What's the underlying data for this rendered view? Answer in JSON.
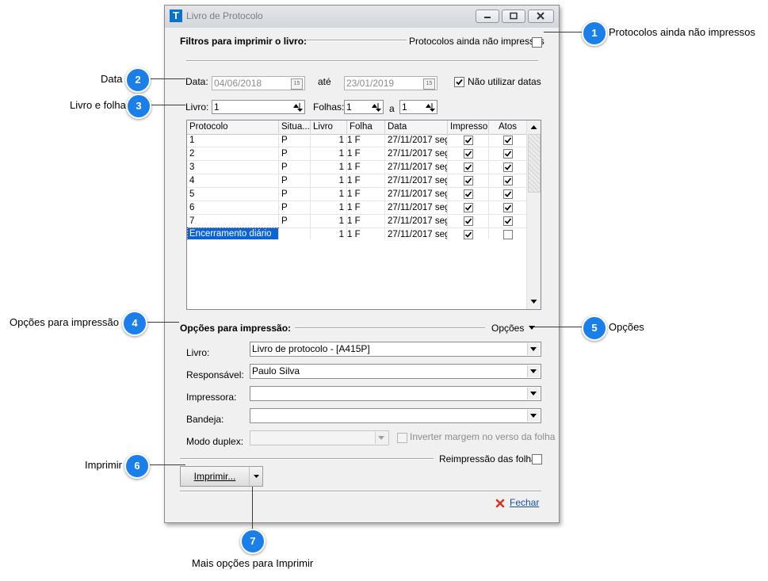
{
  "window": {
    "title": "Livro de Protocolo",
    "app_icon": "T"
  },
  "filters": {
    "section_label": "Filtros para imprimir o livro:",
    "unprinted_label": "Protocolos ainda não impressos",
    "unprinted_checked": false,
    "date_label": "Data:",
    "date_from": "04/06/2018",
    "until_label": "até",
    "date_to": "23/01/2019",
    "no_dates_label": "Não utilizar datas",
    "no_dates_checked": true,
    "book_label": "Livro:",
    "book_value": "1",
    "pages_label": "Folhas:",
    "page_from": "1",
    "to_label": "a",
    "page_to": "1"
  },
  "grid": {
    "columns": [
      "Protocolo",
      "Situa...",
      "Livro",
      "Folha",
      "Data",
      "Impresso",
      "Atos"
    ],
    "rows": [
      {
        "protocolo": "1",
        "situacao": "P",
        "livro": "1",
        "folha": "1 F",
        "data": "27/11/2017 seg",
        "impresso": true,
        "atos": true
      },
      {
        "protocolo": "2",
        "situacao": "P",
        "livro": "1",
        "folha": "1 F",
        "data": "27/11/2017 seg",
        "impresso": true,
        "atos": true
      },
      {
        "protocolo": "3",
        "situacao": "P",
        "livro": "1",
        "folha": "1 F",
        "data": "27/11/2017 seg",
        "impresso": true,
        "atos": true
      },
      {
        "protocolo": "4",
        "situacao": "P",
        "livro": "1",
        "folha": "1 F",
        "data": "27/11/2017 seg",
        "impresso": true,
        "atos": true
      },
      {
        "protocolo": "5",
        "situacao": "P",
        "livro": "1",
        "folha": "1 F",
        "data": "27/11/2017 seg",
        "impresso": true,
        "atos": true
      },
      {
        "protocolo": "6",
        "situacao": "P",
        "livro": "1",
        "folha": "1 F",
        "data": "27/11/2017 seg",
        "impresso": true,
        "atos": true
      },
      {
        "protocolo": "7",
        "situacao": "P",
        "livro": "1",
        "folha": "1 F",
        "data": "27/11/2017 seg",
        "impresso": true,
        "atos": true
      },
      {
        "protocolo": "Encerramento diário",
        "situacao": "",
        "livro": "1",
        "folha": "1 F",
        "data": "27/11/2017 seg",
        "impresso": true,
        "atos": false
      }
    ]
  },
  "print_options": {
    "section_label": "Opções para impressão:",
    "options_menu": "Opções",
    "book_label": "Livro:",
    "book_value": "Livro de protocolo - [A415P]",
    "responsible_label": "Responsável:",
    "responsible_value": "Paulo Silva",
    "printer_label": "Impressora:",
    "printer_value": "",
    "tray_label": "Bandeja:",
    "tray_value": "",
    "duplex_label": "Modo duplex:",
    "duplex_value": "",
    "invert_margin_label": "Inverter margem no verso da folha",
    "invert_margin_checked": false,
    "reprint_label": "Reimpressão das folhas",
    "reprint_checked": false
  },
  "buttons": {
    "print": "Imprimir...",
    "close": "Fechar"
  },
  "callouts": [
    {
      "number": "1",
      "text": "Protocolos ainda não impressos"
    },
    {
      "number": "2",
      "text": "Data"
    },
    {
      "number": "3",
      "text": "Livro e folha"
    },
    {
      "number": "4",
      "text": "Opções para impressão"
    },
    {
      "number": "5",
      "text": "Opções"
    },
    {
      "number": "6",
      "text": "Imprimir"
    },
    {
      "number": "7",
      "text": "Mais opções para Imprimir"
    }
  ],
  "colors": {
    "callout": "#1a7fe8",
    "selection": "#0a64d6",
    "close_icon": "#d9342b"
  }
}
